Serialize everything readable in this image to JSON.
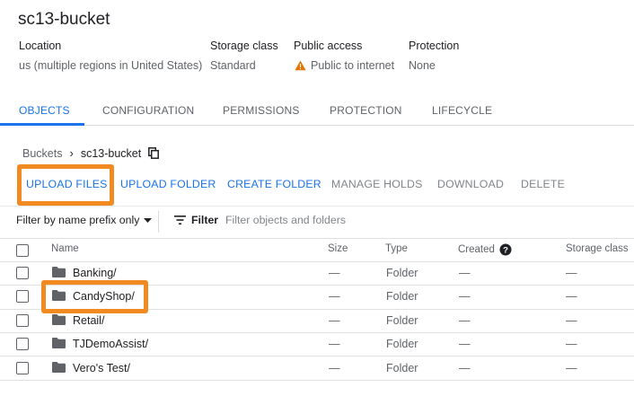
{
  "bucket": {
    "title": "sc13-bucket"
  },
  "meta": {
    "location": {
      "label": "Location",
      "value": "us (multiple regions in United States)"
    },
    "storage_class": {
      "label": "Storage class",
      "value": "Standard"
    },
    "public_access": {
      "label": "Public access",
      "value": "Public to internet",
      "icon": "warning-icon",
      "icon_color": "#e37400"
    },
    "protection": {
      "label": "Protection",
      "value": "None"
    }
  },
  "tabs": [
    {
      "label": "OBJECTS",
      "active": true
    },
    {
      "label": "CONFIGURATION"
    },
    {
      "label": "PERMISSIONS"
    },
    {
      "label": "PROTECTION"
    },
    {
      "label": "LIFECYCLE"
    }
  ],
  "breadcrumb": {
    "root": "Buckets",
    "separator": "›",
    "current": "sc13-bucket",
    "copy_icon": "copy-icon"
  },
  "actions": {
    "upload_files": "UPLOAD FILES",
    "upload_folder": "UPLOAD FOLDER",
    "create_folder": "CREATE FOLDER",
    "manage_holds": "MANAGE HOLDS",
    "download": "DOWNLOAD",
    "delete": "DELETE"
  },
  "filter": {
    "mode": "Filter by name prefix only",
    "label": "Filter",
    "placeholder": "Filter objects and folders"
  },
  "table": {
    "headers": {
      "name": "Name",
      "size": "Size",
      "type": "Type",
      "created": "Created",
      "storage_class": "Storage class"
    },
    "rows": [
      {
        "name": "Banking/",
        "size": "—",
        "type": "Folder",
        "created": "—",
        "storage_class": "—"
      },
      {
        "name": "CandyShop/",
        "size": "—",
        "type": "Folder",
        "created": "—",
        "storage_class": "—"
      },
      {
        "name": "Retail/",
        "size": "—",
        "type": "Folder",
        "created": "—",
        "storage_class": "—"
      },
      {
        "name": "TJDemoAssist/",
        "size": "—",
        "type": "Folder",
        "created": "—",
        "storage_class": "—"
      },
      {
        "name": "Vero's Test/",
        "size": "—",
        "type": "Folder",
        "created": "—",
        "storage_class": "—"
      }
    ]
  },
  "colors": {
    "accent": "#1a73e8",
    "highlight": "#f28a22",
    "warning": "#e37400"
  }
}
